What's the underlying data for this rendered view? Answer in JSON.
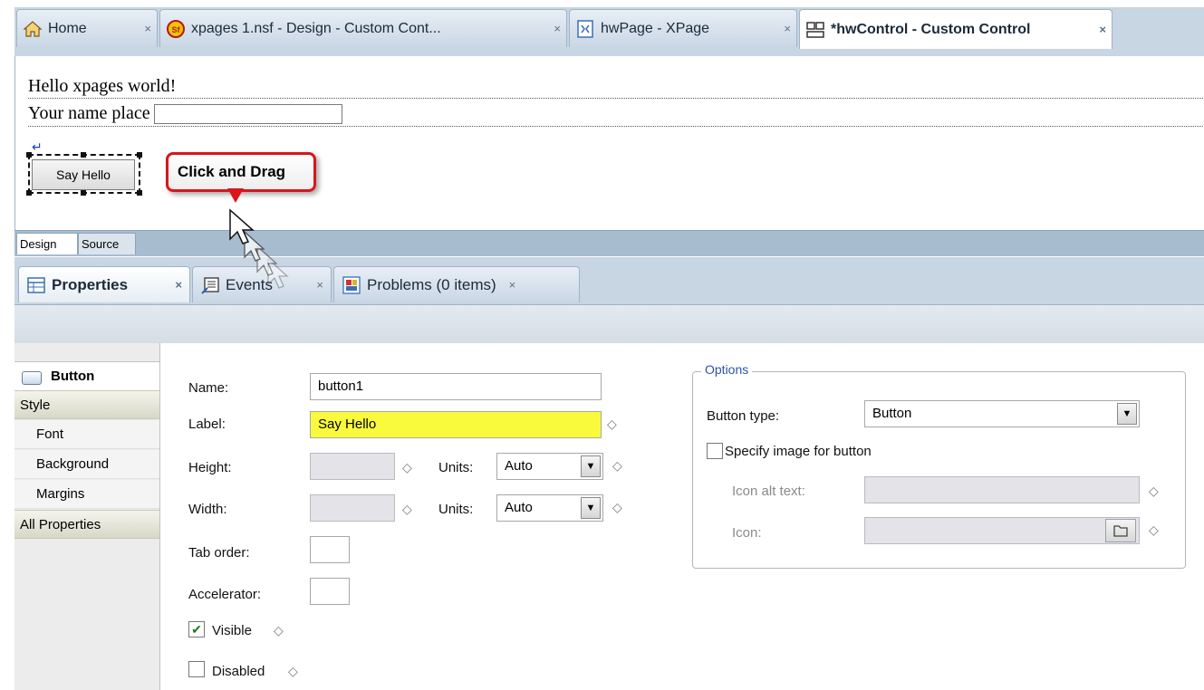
{
  "editor_tabs": [
    {
      "label": "Home",
      "icon": "home-icon",
      "close": "×"
    },
    {
      "label": "xpages 1.nsf - Design - Custom Cont...",
      "icon": "database-icon",
      "close": "×"
    },
    {
      "label": "hwPage - XPage",
      "icon": "xpage-icon",
      "close": "×"
    },
    {
      "label": "*hwControl - Custom Control",
      "icon": "custom-control-icon",
      "close": "×"
    }
  ],
  "canvas": {
    "hello_text": "Hello xpages world!",
    "name_label": "Your name place",
    "name_value": "",
    "button_label": "Say Hello",
    "callout_text": "Click and Drag",
    "return_marker": "↵"
  },
  "mode_tabs": {
    "design": "Design",
    "source": "Source"
  },
  "view_tabs": [
    {
      "label": "Properties",
      "icon": "properties-icon",
      "close": "×"
    },
    {
      "label": "Events",
      "icon": "events-icon",
      "close": "×"
    },
    {
      "label": "Problems (0 items)",
      "icon": "problems-icon",
      "close": "×"
    }
  ],
  "nav": {
    "button": "Button",
    "style": "Style",
    "font": "Font",
    "background": "Background",
    "margins": "Margins",
    "all_properties": "All Properties"
  },
  "props": {
    "name_label": "Name:",
    "name_value": "button1",
    "label_label": "Label:",
    "label_value": "Say Hello",
    "height_label": "Height:",
    "height_value": "",
    "width_label": "Width:",
    "width_value": "",
    "units_label": "Units:",
    "height_units": "Auto",
    "width_units": "Auto",
    "tab_order_label": "Tab order:",
    "tab_order_value": "",
    "accelerator_label": "Accelerator:",
    "accelerator_value": "",
    "visible_label": "Visible",
    "visible_checked": true,
    "disabled_label": "Disabled",
    "disabled_checked": false,
    "diamond": "◇"
  },
  "options": {
    "title": "Options",
    "button_type_label": "Button type:",
    "button_type_value": "Button",
    "specify_image_label": "Specify image for button",
    "icon_alt_label": "Icon alt text:",
    "icon_alt_value": "",
    "icon_label": "Icon:",
    "icon_value": ""
  },
  "colors": {
    "tabbar": "#c8d5e2",
    "highlight_field": "#fafa3c",
    "callout_border": "#d8161c",
    "options_title": "#2b55a8"
  }
}
